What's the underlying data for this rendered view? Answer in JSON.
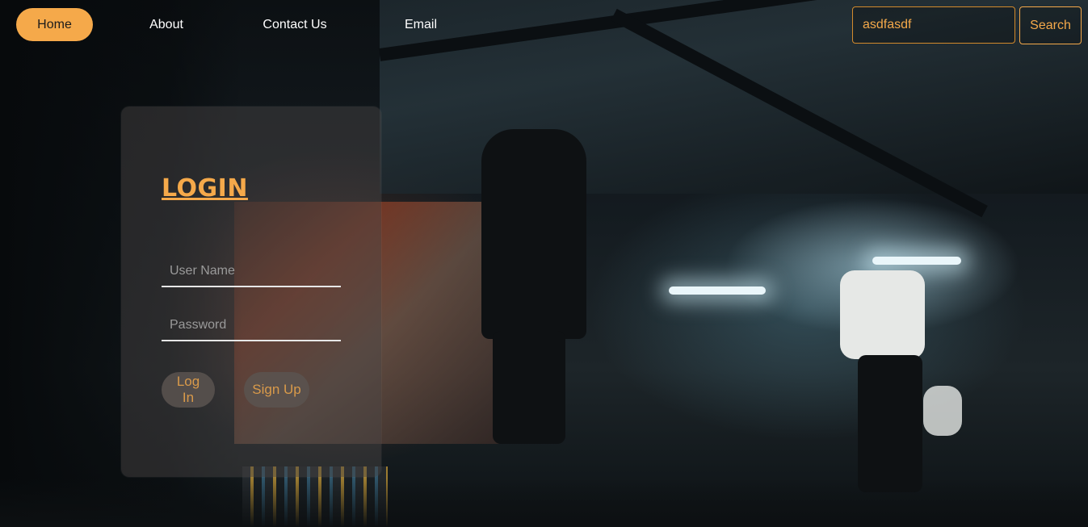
{
  "nav": {
    "items": [
      {
        "label": "Home",
        "active": true
      },
      {
        "label": "About"
      },
      {
        "label": "Contact Us"
      },
      {
        "label": "Email"
      }
    ]
  },
  "search": {
    "value": "asdfasdf",
    "button_label": "Search"
  },
  "login": {
    "title": "LOGIN",
    "username_placeholder": "User Name",
    "password_placeholder": "Password",
    "login_button": "Log In",
    "signup_button": "Sign Up"
  },
  "colors": {
    "accent": "#f5a94a",
    "card_bg": "rgba(75,72,70,0.45)",
    "text": "#ffffff"
  }
}
